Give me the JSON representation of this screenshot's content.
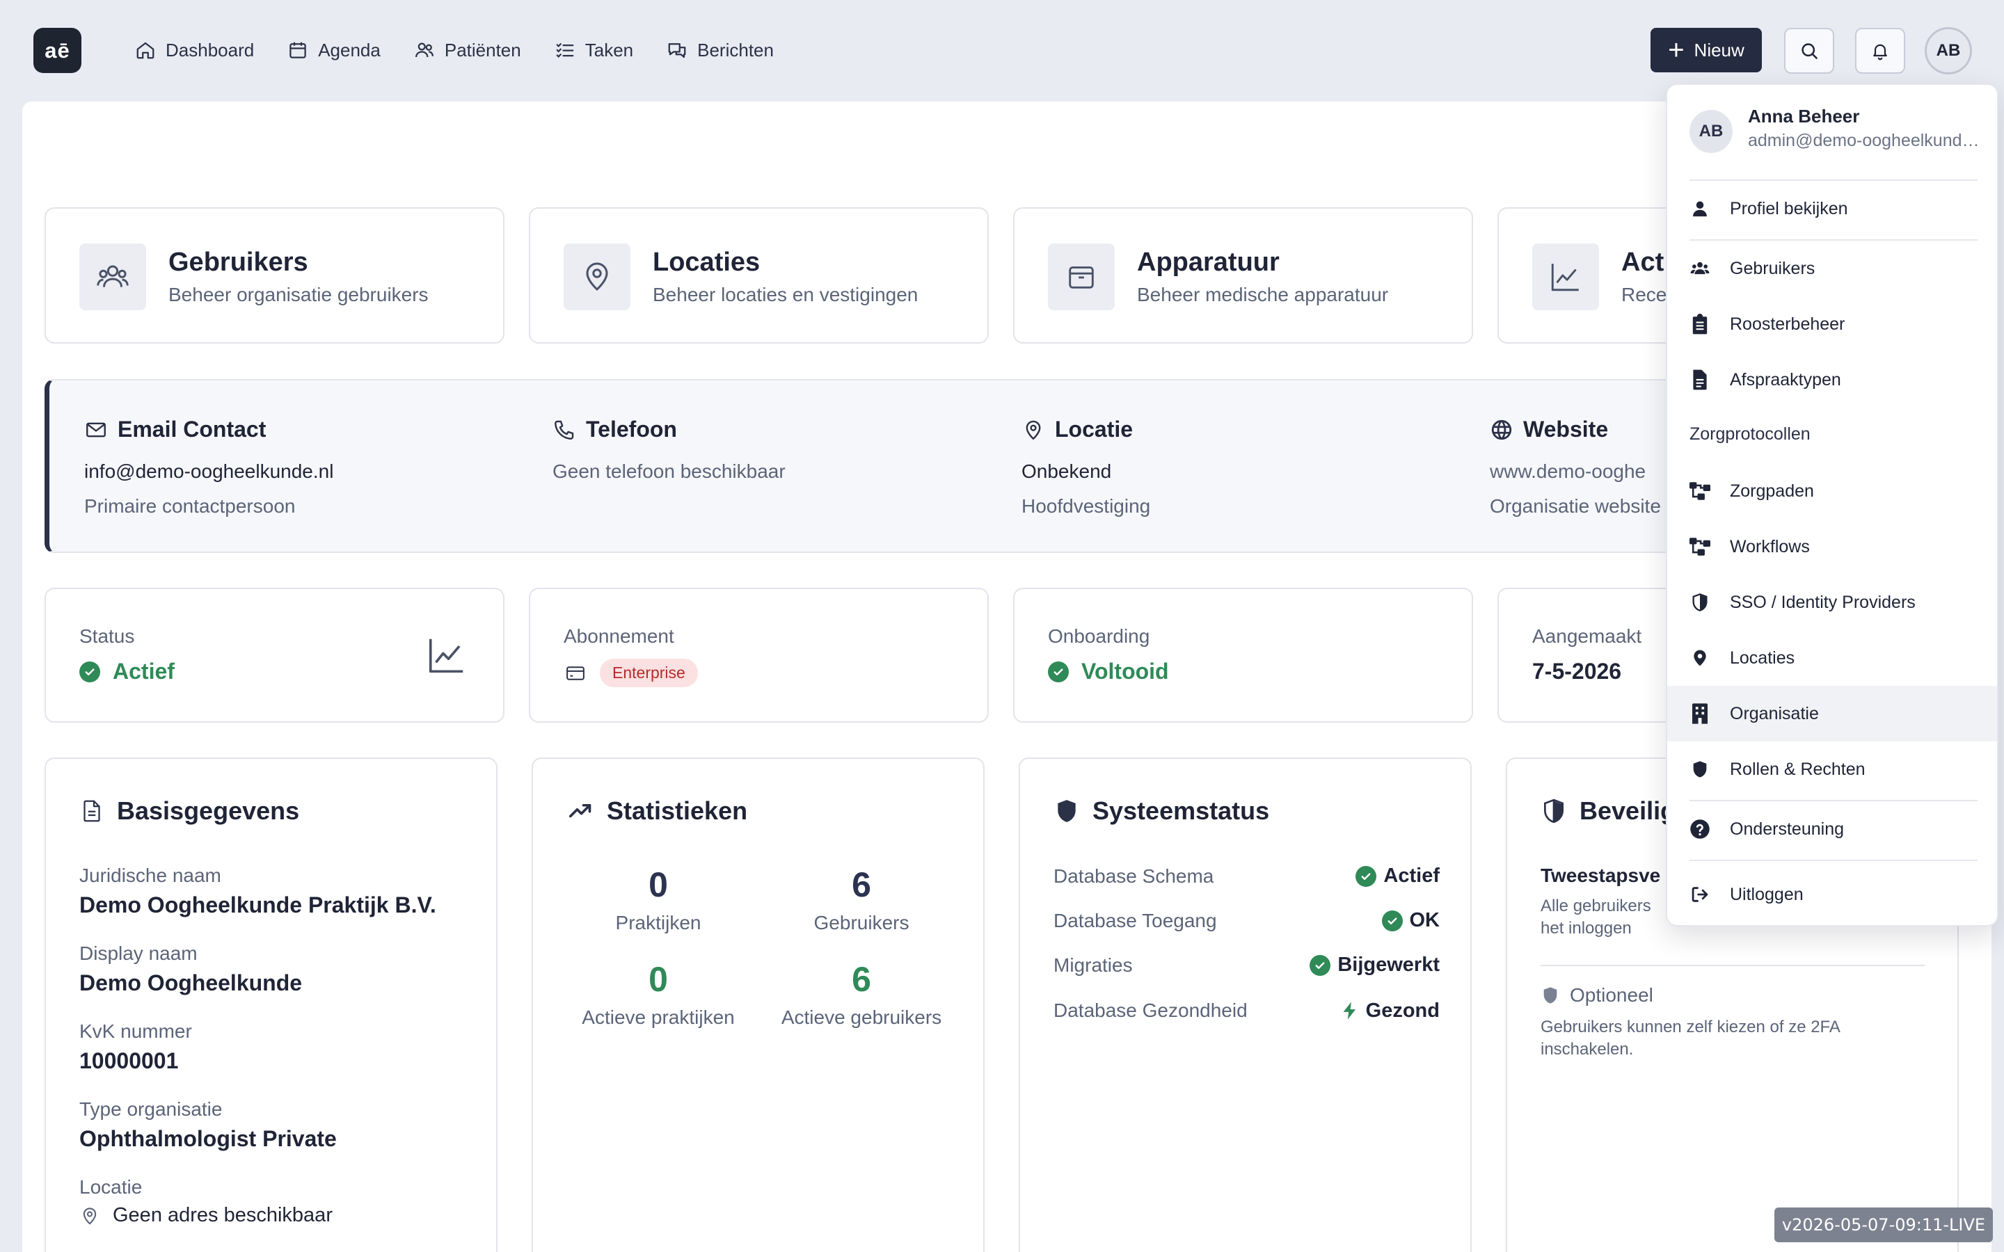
{
  "logo": "aē",
  "nav": {
    "dashboard": "Dashboard",
    "agenda": "Agenda",
    "patienten": "Patiënten",
    "taken": "Taken",
    "berichten": "Berichten"
  },
  "header": {
    "new_label": "Nieuw",
    "avatar_initials": "AB"
  },
  "tiles": [
    {
      "title": "Gebruikers",
      "subtitle": "Beheer organisatie gebruikers"
    },
    {
      "title": "Locaties",
      "subtitle": "Beheer locaties en vestigingen"
    },
    {
      "title": "Apparatuur",
      "subtitle": "Beheer medische apparatuur"
    },
    {
      "title": "Act",
      "subtitle": "Rece"
    }
  ],
  "contact": {
    "email": {
      "title": "Email Contact",
      "value": "info@demo-oogheelkunde.nl",
      "sub": "Primaire contactpersoon"
    },
    "phone": {
      "title": "Telefoon",
      "value": "Geen telefoon beschikbaar"
    },
    "location": {
      "title": "Locatie",
      "value": "Onbekend",
      "sub": "Hoofdvestiging"
    },
    "website": {
      "title": "Website",
      "value": "www.demo-ooghe",
      "sub": "Organisatie website"
    }
  },
  "stats_row": {
    "status": {
      "label": "Status",
      "value": "Actief"
    },
    "subscription": {
      "label": "Abonnement",
      "value": "Enterprise"
    },
    "onboarding": {
      "label": "Onboarding",
      "value": "Voltooid"
    },
    "created": {
      "label": "Aangemaakt",
      "value": "7-5-2026"
    }
  },
  "basis": {
    "title": "Basisgegevens",
    "legal_label": "Juridische naam",
    "legal_value": "Demo Oogheelkunde Praktijk B.V.",
    "display_label": "Display naam",
    "display_value": "Demo Oogheelkunde",
    "kvk_label": "KvK nummer",
    "kvk_value": "10000001",
    "type_label": "Type organisatie",
    "type_value": "Ophthalmologist Private",
    "loc_label": "Locatie",
    "loc_value": "Geen adres beschikbaar"
  },
  "statistieken": {
    "title": "Statistieken",
    "items": [
      {
        "value": "0",
        "label": "Praktijken"
      },
      {
        "value": "6",
        "label": "Gebruikers"
      },
      {
        "value": "0",
        "label": "Actieve praktijken"
      },
      {
        "value": "6",
        "label": "Actieve gebruikers"
      }
    ]
  },
  "systeem": {
    "title": "Systeemstatus",
    "rows": [
      {
        "key": "Database Schema",
        "value": "Actief"
      },
      {
        "key": "Database Toegang",
        "value": "OK"
      },
      {
        "key": "Migraties",
        "value": "Bijgewerkt"
      },
      {
        "key": "Database Gezondheid",
        "value": "Gezond"
      }
    ]
  },
  "beveiliging": {
    "title": "Beveilig",
    "twofa_title": "Tweestapsve",
    "twofa_desc_1": "Alle gebruikers",
    "twofa_desc_2": "het inloggen",
    "optional_title": "Optioneel",
    "optional_desc_1": "Gebruikers kunnen zelf kiezen of ze 2FA",
    "optional_desc_2": "inschakelen."
  },
  "dropdown": {
    "initials": "AB",
    "name": "Anna Beheer",
    "email": "admin@demo-oogheelkunde.nl",
    "profile": "Profiel bekijken",
    "users": "Gebruikers",
    "roster": "Roosterbeheer",
    "appointment_types": "Afspraaktypen",
    "section": "Zorgprotocollen",
    "care_paths": "Zorgpaden",
    "workflows": "Workflows",
    "sso": "SSO / Identity Providers",
    "locations": "Locaties",
    "organisation": "Organisatie",
    "roles": "Rollen & Rechten",
    "support": "Ondersteuning",
    "logout": "Uitloggen"
  },
  "version": "v2026-05-07-09:11-LIVE",
  "colors": {
    "brand_dark": "#252b40",
    "success": "#2f8a57",
    "badge_bg": "#fbe1e1",
    "badge_text": "#b32d2d"
  }
}
